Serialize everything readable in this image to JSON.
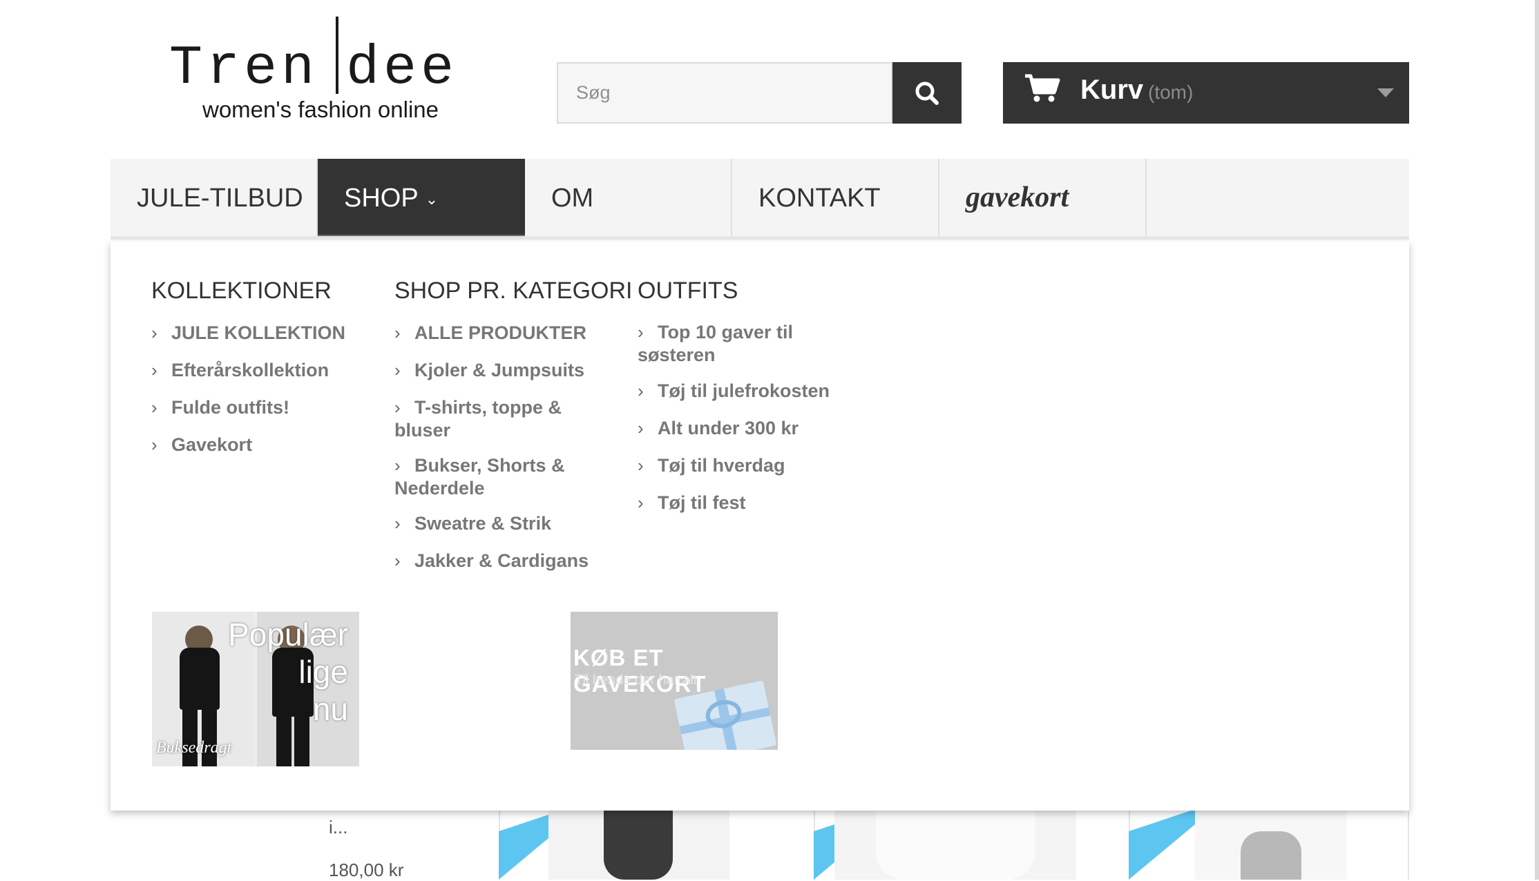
{
  "logo": {
    "name_part1": "Tren",
    "name_part2": "dee",
    "tagline": "women's fashion online"
  },
  "search": {
    "placeholder": "Søg"
  },
  "cart": {
    "label": "Kurv",
    "status": "(tom)"
  },
  "nav": {
    "items": [
      {
        "label": "JULE-TILBUD"
      },
      {
        "label": "SHOP",
        "caret": "⌄"
      },
      {
        "label": "OM"
      },
      {
        "label": "KONTAKT"
      },
      {
        "label": "gavekort"
      }
    ]
  },
  "menu": {
    "collections": {
      "title": "KOLLEKTIONER",
      "links": [
        "JULE KOLLEKTION",
        "Efterårskollektion",
        "Fulde outfits!",
        "Gavekort"
      ]
    },
    "categories": {
      "title": "SHOP PR. KATEGORI",
      "links": [
        "ALLE PRODUKTER",
        "Kjoler & Jumpsuits",
        "T-shirts, toppe & bluser",
        "Bukser, Shorts & Nederdele",
        "Sweatre & Strik",
        "Jakker & Cardigans"
      ]
    },
    "outfits": {
      "title": "OUTFITS",
      "links": [
        "Top 10 gaver til søsteren",
        "Tøj til julefrokosten",
        "Alt under 300 kr",
        "Tøj til hverdag",
        "Tøj til fest"
      ]
    },
    "banner_popular": {
      "line1": "Populær",
      "line2": "lige",
      "line3": "nu",
      "caption": "Buksedragt"
    },
    "banner_gift": {
      "title": "KØB ET GAVEKORT",
      "subtitle": "Til hende der har alt"
    }
  },
  "products_peek": {
    "text_fragment": "i...",
    "price": "180,00 kr"
  }
}
